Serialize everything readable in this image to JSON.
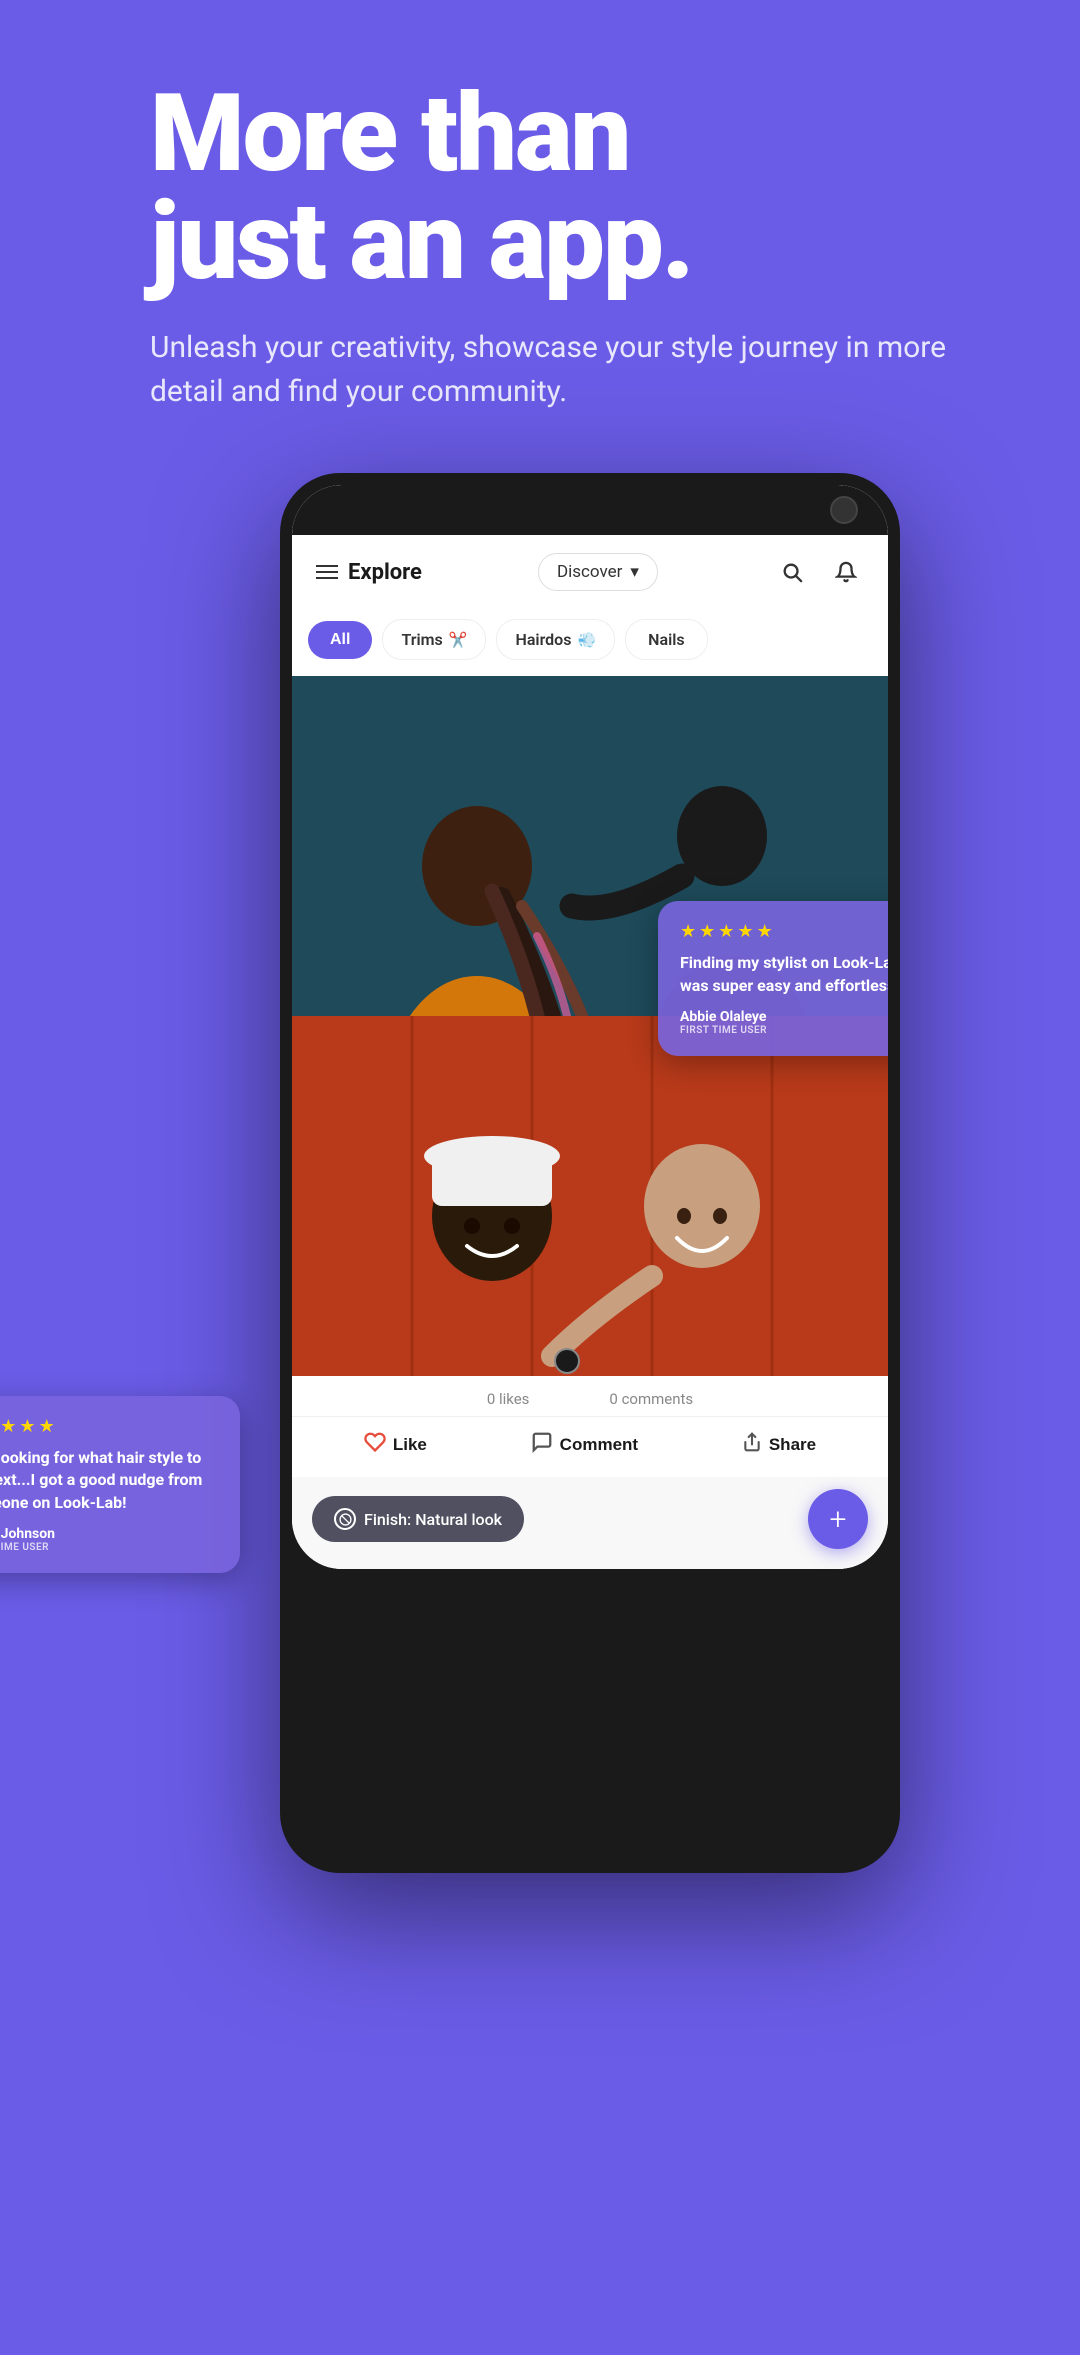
{
  "hero": {
    "title_line1": "More than",
    "title_line2": "just an app.",
    "subtitle": "Unleash your creativity, showcase your style journey in more detail and find your community."
  },
  "app": {
    "header": {
      "explore_label": "Explore",
      "discover_label": "Discover",
      "menu_icon": "☰",
      "search_icon": "🔍",
      "bell_icon": "🔔"
    },
    "filter_tabs": [
      {
        "label": "All",
        "active": true
      },
      {
        "label": "Trims",
        "icon": "✂️",
        "active": false
      },
      {
        "label": "Hairdos",
        "icon": "💨",
        "active": false
      },
      {
        "label": "Nails",
        "active": false
      }
    ],
    "review1": {
      "stars": "★★★★★",
      "text": "Finding my stylist on Look-Lab was super easy and effortless!",
      "name": "Abbie Olaleye",
      "tag": "FIRST TIME USER"
    },
    "review2": {
      "stars": "★★★★★",
      "text": "Was looking for what hair style to try next...I got a good nudge from someone on Look-Lab!",
      "name": "David Johnson",
      "tag": "FIRST TIME USER"
    },
    "stats": {
      "likes": "0 likes",
      "comments": "0 comments"
    },
    "actions": {
      "like": "Like",
      "comment": "Comment",
      "share": "Share"
    },
    "finish_pill": "Finish: Natural look",
    "fab_label": "+"
  }
}
